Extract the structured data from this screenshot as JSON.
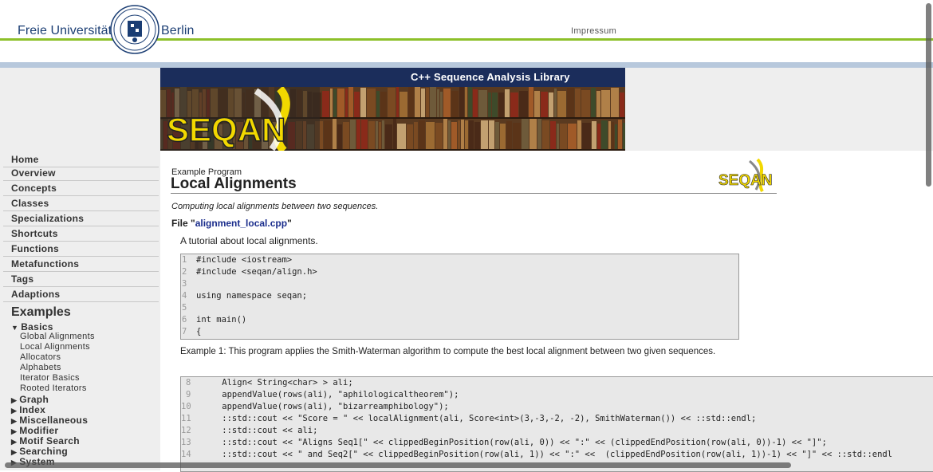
{
  "header": {
    "logo_left": "Freie Universität",
    "logo_right": "Berlin",
    "impressum": "Impressum"
  },
  "banner": {
    "title": "C++ Sequence Analysis Library",
    "logo_text": "SEQAN"
  },
  "sidebar": {
    "items": [
      {
        "label": "Home"
      },
      {
        "label": "Overview"
      },
      {
        "label": "Concepts"
      },
      {
        "label": "Classes"
      },
      {
        "label": "Specializations"
      },
      {
        "label": "Shortcuts"
      },
      {
        "label": "Functions"
      },
      {
        "label": "Metafunctions"
      },
      {
        "label": "Tags"
      },
      {
        "label": "Adaptions"
      }
    ],
    "examples_heading": "Examples",
    "basics_label": "Basics",
    "basics_items": [
      "Global Alignments",
      "Local Alignments",
      "Allocators",
      "Alphabets",
      "Iterator Basics",
      "Rooted Iterators"
    ],
    "groups": [
      "Graph",
      "Index",
      "Miscellaneous",
      "Modifier",
      "Motif Search",
      "Searching",
      "System"
    ]
  },
  "main": {
    "example_label": "Example Program",
    "title": "Local Alignments",
    "description": "Computing local alignments between two sequences.",
    "file_prefix": "File \"",
    "file_name": "alignment_local.cpp",
    "file_suffix": "\"",
    "tutorial": "A tutorial about local alignments.",
    "code1": [
      {
        "n": "1",
        "t": "#include <iostream>"
      },
      {
        "n": "2",
        "t": "#include <seqan/align.h>"
      },
      {
        "n": "3",
        "t": ""
      },
      {
        "n": "4",
        "t": "using namespace seqan;"
      },
      {
        "n": "5",
        "t": ""
      },
      {
        "n": "6",
        "t": "int main()"
      },
      {
        "n": "7",
        "t": "{"
      }
    ],
    "example_text": "Example 1: This program applies the Smith-Waterman algorithm to compute the best local alignment between two given sequences.",
    "code2": [
      {
        "n": "8",
        "t": "    Align< String<char> > ali;"
      },
      {
        "n": "9",
        "t": "    appendValue(rows(ali), \"aphilologicaltheorem\");"
      },
      {
        "n": "10",
        "t": "    appendValue(rows(ali), \"bizarreamphibology\");"
      },
      {
        "n": "11",
        "t": "    ::std::cout << \"Score = \" << localAlignment(ali, Score<int>(3,-3,-2, -2), SmithWaterman()) << ::std::endl;"
      },
      {
        "n": "12",
        "t": "    ::std::cout << ali;"
      },
      {
        "n": "13",
        "t": "    ::std::cout << \"Aligns Seq1[\" << clippedBeginPosition(row(ali, 0)) << \":\" << (clippedEndPosition(row(ali, 0))-1) << \"]\";"
      },
      {
        "n": "14",
        "t": "    ::std::cout << \" and Seq2[\" << clippedBeginPosition(row(ali, 1)) << \":\" <<  (clippedEndPosition(row(ali, 1))-1) << \"]\" << ::std::endl"
      }
    ]
  },
  "colors": {
    "green_line": "#8dc02a",
    "blue_band": "#b7c8dc",
    "banner_bar": "#1b2d5b",
    "link": "#1a2d8c",
    "seqan_yellow": "#f2d800"
  }
}
